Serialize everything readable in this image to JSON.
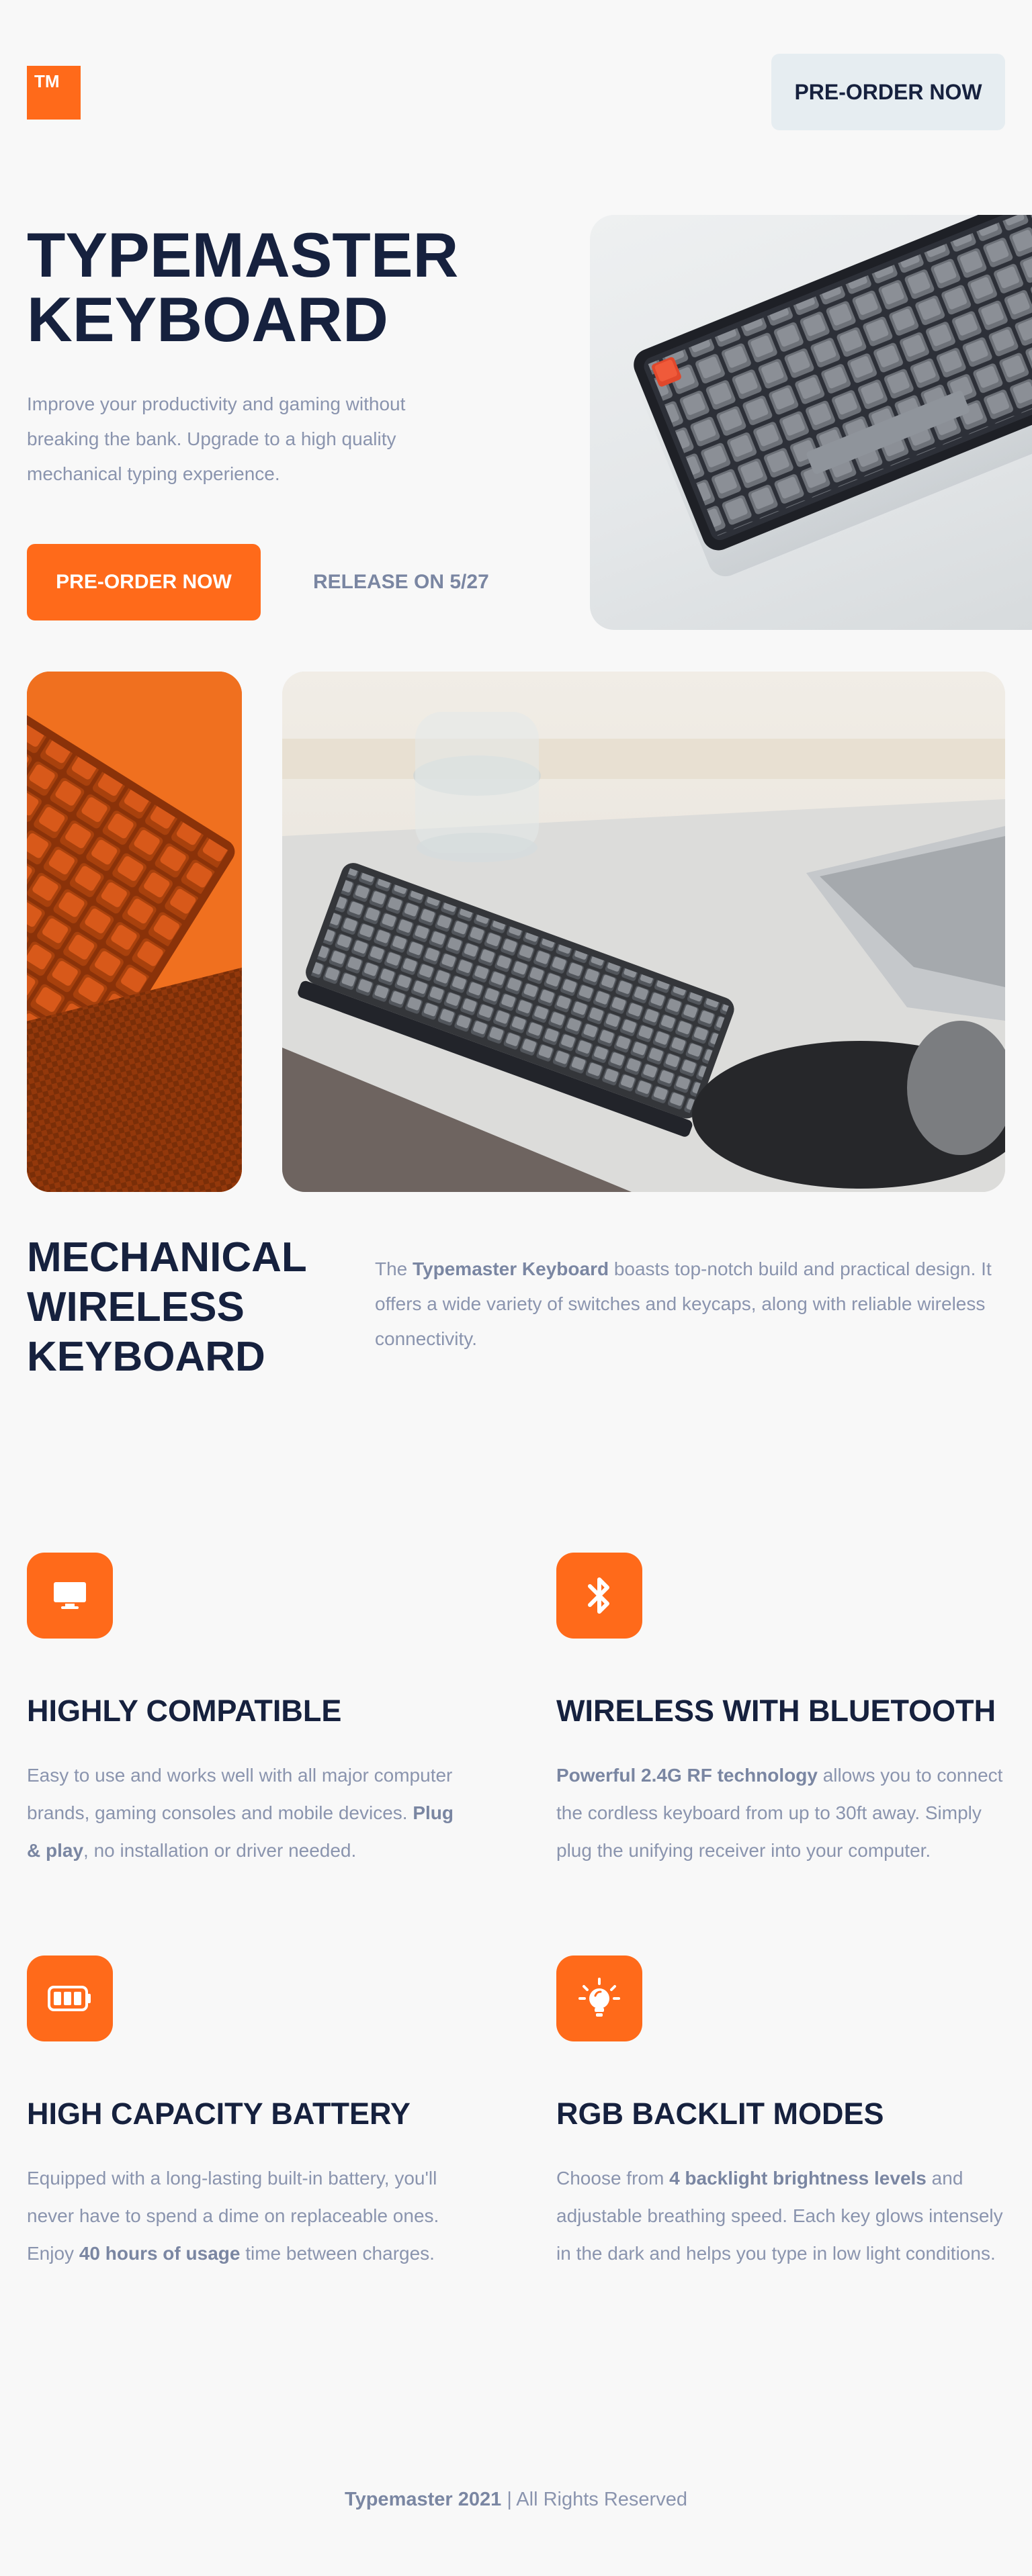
{
  "header": {
    "logo_text": "TM",
    "cta_label": "PRE-ORDER NOW"
  },
  "hero": {
    "title_line1": "TYPEMASTER",
    "title_line2": "KEYBOARD",
    "description": "Improve your productivity and gaming without breaking the bank. Upgrade to a high quality mechanical typing experience.",
    "cta_label": "PRE-ORDER NOW",
    "release_label": "RELEASE ON 5/27"
  },
  "about": {
    "title_line1": "MECHANICAL",
    "title_line2": "WIRELESS",
    "title_line3": "KEYBOARD",
    "desc_prefix": "The ",
    "desc_bold": "Typemaster Keyboard",
    "desc_suffix": " boasts top-notch build and practical design. It offers a wide variety of switches and keycaps, along with reliable wireless connectivity."
  },
  "features": [
    {
      "icon": "monitor-icon",
      "title": "HIGHLY COMPATIBLE",
      "desc_a": "Easy to use and works well with all major computer brands, gaming consoles and mobile devices. ",
      "desc_bold": "Plug & play",
      "desc_b": ", no installation or driver needed."
    },
    {
      "icon": "bluetooth-icon",
      "title": "WIRELESS WITH BLUETOOTH",
      "desc_a": "",
      "desc_bold": "Powerful 2.4G RF technology",
      "desc_b": " allows you to connect the cordless keyboard from up to 30ft away. Simply plug the unifying receiver into your computer."
    },
    {
      "icon": "battery-icon",
      "title": "HIGH CAPACITY BATTERY",
      "desc_a": "Equipped with a long-lasting built-in battery, you'll never have to spend a dime on replaceable ones. Enjoy ",
      "desc_bold": "40 hours of usage",
      "desc_b": " time between charges."
    },
    {
      "icon": "lightbulb-icon",
      "title": "RGB BACKLIT MODES",
      "desc_a": "Choose from ",
      "desc_bold": "4 backlight brightness levels",
      "desc_b": " and adjustable breathing speed. Each key glows intensely in the dark and helps you type in low light conditions."
    }
  ],
  "footer": {
    "brand": "Typemaster 2021",
    "rights": "| All Rights Reserved"
  },
  "colors": {
    "accent": "#ff6a1a",
    "heading": "#16213e",
    "body_text": "#8a94ae",
    "background": "#f8f8f8",
    "secondary_button": "#e6edf1"
  }
}
